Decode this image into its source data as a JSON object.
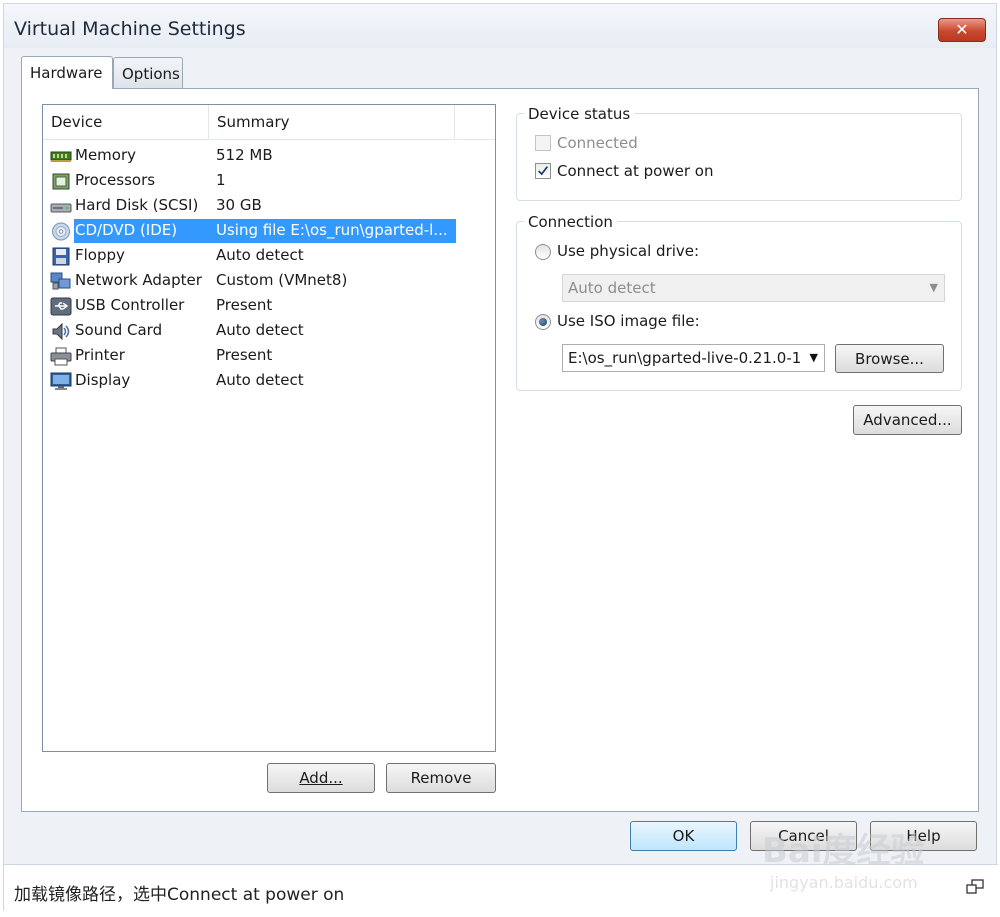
{
  "window": {
    "title": "Virtual Machine Settings",
    "close_glyph": "✕"
  },
  "tabs": [
    {
      "label": "Hardware",
      "active": true
    },
    {
      "label": "Options",
      "active": false
    }
  ],
  "device_list": {
    "columns": [
      "Device",
      "Summary"
    ],
    "rows": [
      {
        "name": "Memory",
        "summary": "512 MB",
        "icon": "memory-icon"
      },
      {
        "name": "Processors",
        "summary": "1",
        "icon": "processor-icon"
      },
      {
        "name": "Hard Disk (SCSI)",
        "summary": "30 GB",
        "icon": "hard-disk-icon"
      },
      {
        "name": "CD/DVD (IDE)",
        "summary": "Using file E:\\os_run\\gparted-l...",
        "icon": "cd-dvd-icon",
        "selected": true
      },
      {
        "name": "Floppy",
        "summary": "Auto detect",
        "icon": "floppy-icon"
      },
      {
        "name": "Network Adapter",
        "summary": "Custom (VMnet8)",
        "icon": "network-adapter-icon"
      },
      {
        "name": "USB Controller",
        "summary": "Present",
        "icon": "usb-icon"
      },
      {
        "name": "Sound Card",
        "summary": "Auto detect",
        "icon": "sound-card-icon"
      },
      {
        "name": "Printer",
        "summary": "Present",
        "icon": "printer-icon"
      },
      {
        "name": "Display",
        "summary": "Auto detect",
        "icon": "display-icon"
      }
    ]
  },
  "buttons": {
    "add": "Add...",
    "remove": "Remove",
    "browse": "Browse...",
    "advanced": "Advanced...",
    "ok": "OK",
    "cancel": "Cancel",
    "help": "Help"
  },
  "device_status": {
    "title": "Device status",
    "connected_label": "Connected",
    "connected_checked": false,
    "connected_enabled": false,
    "connect_at_power_on_label": "Connect at power on",
    "connect_at_power_on_checked": true
  },
  "connection": {
    "title": "Connection",
    "physical_drive_label": "Use physical drive:",
    "physical_drive_selected": false,
    "physical_drive_value": "Auto detect",
    "iso_label": "Use ISO image file:",
    "iso_selected": true,
    "iso_value": "E:\\os_run\\gparted-live-0.21.0-1"
  },
  "caption": {
    "text": "加载镜像路径，选中Connect at power on"
  },
  "watermark": {
    "main": "Bai度经验",
    "sub": "jingyan.baidu.com"
  },
  "colors": {
    "selection": "#3399ff",
    "close_button": "#c9482e",
    "primary_button": "#bee6fd"
  }
}
